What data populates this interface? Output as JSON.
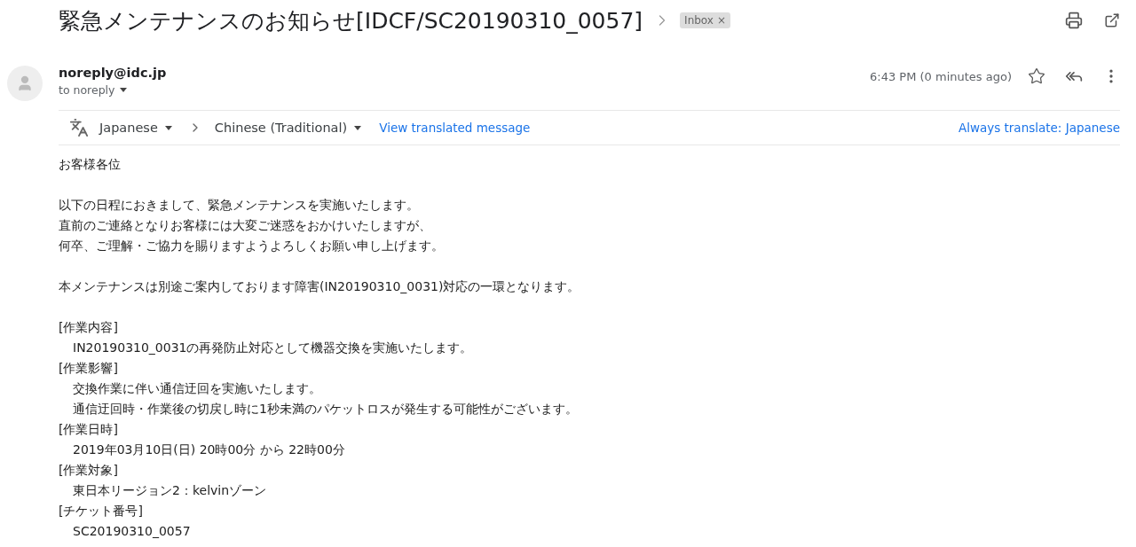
{
  "subject": "緊急メンテナンスのお知らせ[IDCF/SC20190310_0057]",
  "label": {
    "text": "Inbox",
    "remove": "×"
  },
  "sender": {
    "email": "noreply@idc.jp",
    "to": "to noreply",
    "time": "6:43 PM (0 minutes ago)",
    "starred": false
  },
  "translate": {
    "from": "Japanese",
    "to": "Chinese (Traditional)",
    "view": "View translated message",
    "always": "Always translate: Japanese"
  },
  "body": [
    {
      "lines": [
        {
          "kind": "plain",
          "text": "お客様各位"
        }
      ]
    },
    {
      "lines": [
        {
          "kind": "plain",
          "text": "以下の日程におきまして、緊急メンテナンスを実施いたします。"
        },
        {
          "kind": "plain",
          "text": "直前のご連絡となりお客様には大変ご迷惑をおかけいたしますが、"
        },
        {
          "kind": "plain",
          "text": "何卒、ご理解・ご協力を賜りますようよろしくお願い申し上げます。"
        }
      ]
    },
    {
      "lines": [
        {
          "kind": "plain",
          "text": "本メンテナンスは別途ご案内しております障害(IN20190310_0031)対応の一環となります。"
        }
      ]
    },
    {
      "lines": [
        {
          "kind": "plain",
          "text": "[作業内容]"
        },
        {
          "kind": "indented",
          "text": "IN20190310_0031の再発防止対応として機器交換を実施いたします。"
        },
        {
          "kind": "plain",
          "text": "[作業影響]"
        },
        {
          "kind": "indented",
          "text": "交換作業に伴い通信迂回を実施いたします。"
        },
        {
          "kind": "indented",
          "text": "通信迂回時・作業後の切戻し時に1秒未満のパケットロスが発生する可能性がございます。"
        },
        {
          "kind": "plain",
          "text": "[作業日時]"
        },
        {
          "kind": "indented",
          "text": "2019年03月10日(日) 20時00分 から 22時00分"
        },
        {
          "kind": "plain",
          "text": "[作業対象]"
        },
        {
          "kind": "indented",
          "text": "東日本リージョン2：kelvinゾーン"
        },
        {
          "kind": "plain",
          "text": "[チケット番号]"
        },
        {
          "kind": "indented",
          "text": "SC20190310_0057"
        }
      ]
    }
  ]
}
